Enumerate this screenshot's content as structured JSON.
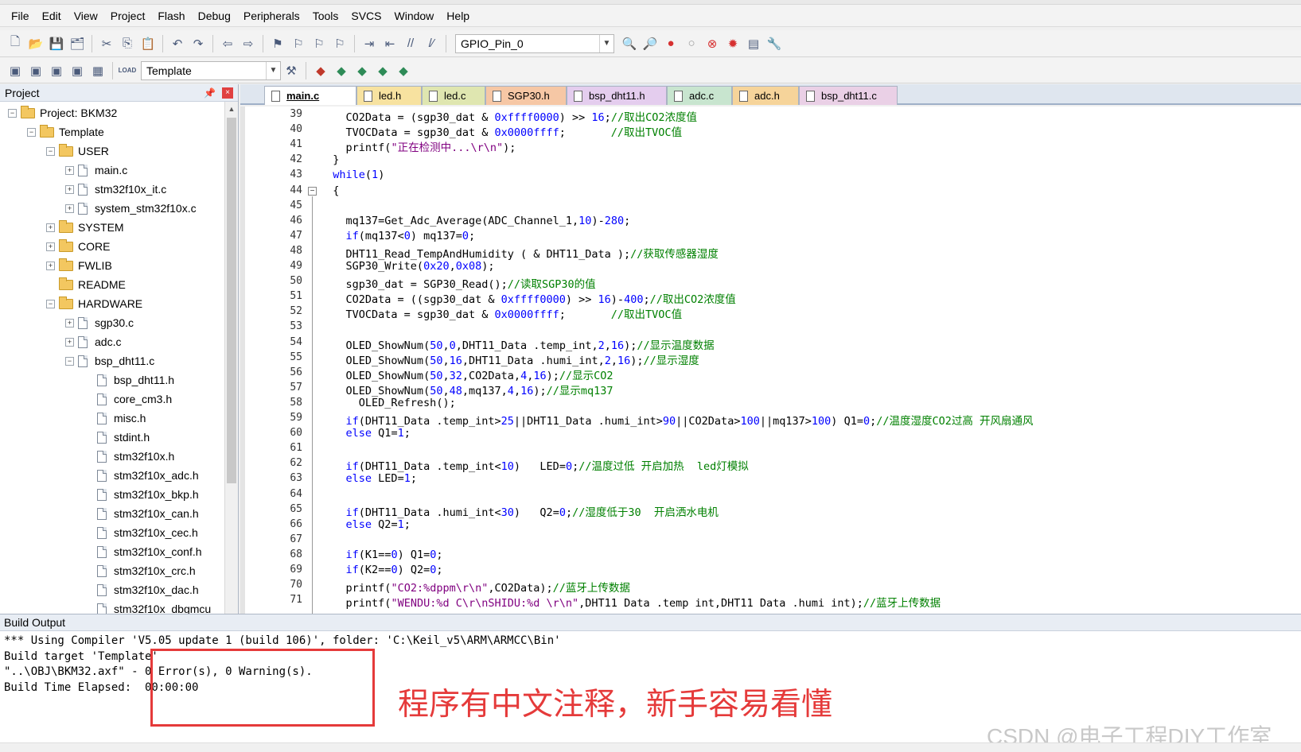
{
  "menu": [
    "File",
    "Edit",
    "View",
    "Project",
    "Flash",
    "Debug",
    "Peripherals",
    "Tools",
    "SVCS",
    "Window",
    "Help"
  ],
  "toolbar1": {
    "target_combo": "GPIO_Pin_0",
    "icons": [
      "new-file-icon",
      "open-folder-icon",
      "save-icon",
      "save-all-icon",
      "cut-icon",
      "copy-icon",
      "paste-icon",
      "undo-icon",
      "redo-icon",
      "nav-back-icon",
      "nav-forward-icon",
      "bookmark-icon",
      "bookmark-prev-icon",
      "bookmark-next-icon",
      "bookmark-clear-icon",
      "indent-icon",
      "unindent-icon",
      "comment-icon",
      "uncomment-icon",
      "find-in-files-icon",
      "find-icon",
      "breakpoint-icon",
      "breakpoint-disable-icon",
      "breakpoint-kill-icon",
      "breakpoint-all-icon",
      "window-layout-icon",
      "config-wrench-icon"
    ]
  },
  "toolbar2": {
    "target_combo": "Template",
    "load_label": "LOAD"
  },
  "project_panel": {
    "title": "Project",
    "tree": [
      {
        "level": 0,
        "toggle": "−",
        "type": "project",
        "label": "Project: BKM32"
      },
      {
        "level": 1,
        "toggle": "−",
        "type": "target",
        "label": "Template"
      },
      {
        "level": 2,
        "toggle": "−",
        "type": "folder",
        "label": "USER"
      },
      {
        "level": 3,
        "toggle": "+",
        "type": "file",
        "label": "main.c"
      },
      {
        "level": 3,
        "toggle": "+",
        "type": "file",
        "label": "stm32f10x_it.c"
      },
      {
        "level": 3,
        "toggle": "+",
        "type": "file",
        "label": "system_stm32f10x.c"
      },
      {
        "level": 2,
        "toggle": "+",
        "type": "folder",
        "label": "SYSTEM"
      },
      {
        "level": 2,
        "toggle": "+",
        "type": "folder",
        "label": "CORE"
      },
      {
        "level": 2,
        "toggle": "+",
        "type": "folder",
        "label": "FWLIB"
      },
      {
        "level": 2,
        "toggle": "",
        "type": "folder",
        "label": "README"
      },
      {
        "level": 2,
        "toggle": "−",
        "type": "folder",
        "label": "HARDWARE"
      },
      {
        "level": 3,
        "toggle": "+",
        "type": "file",
        "label": "sgp30.c"
      },
      {
        "level": 3,
        "toggle": "+",
        "type": "file",
        "label": "adc.c"
      },
      {
        "level": 3,
        "toggle": "−",
        "type": "file",
        "label": "bsp_dht11.c"
      },
      {
        "level": 4,
        "toggle": "",
        "type": "file",
        "label": "bsp_dht11.h"
      },
      {
        "level": 4,
        "toggle": "",
        "type": "file",
        "label": "core_cm3.h"
      },
      {
        "level": 4,
        "toggle": "",
        "type": "file",
        "label": "misc.h"
      },
      {
        "level": 4,
        "toggle": "",
        "type": "file",
        "label": "stdint.h"
      },
      {
        "level": 4,
        "toggle": "",
        "type": "file",
        "label": "stm32f10x.h"
      },
      {
        "level": 4,
        "toggle": "",
        "type": "file",
        "label": "stm32f10x_adc.h"
      },
      {
        "level": 4,
        "toggle": "",
        "type": "file",
        "label": "stm32f10x_bkp.h"
      },
      {
        "level": 4,
        "toggle": "",
        "type": "file",
        "label": "stm32f10x_can.h"
      },
      {
        "level": 4,
        "toggle": "",
        "type": "file",
        "label": "stm32f10x_cec.h"
      },
      {
        "level": 4,
        "toggle": "",
        "type": "file",
        "label": "stm32f10x_conf.h"
      },
      {
        "level": 4,
        "toggle": "",
        "type": "file",
        "label": "stm32f10x_crc.h"
      },
      {
        "level": 4,
        "toggle": "",
        "type": "file",
        "label": "stm32f10x_dac.h"
      },
      {
        "level": 4,
        "toggle": "",
        "type": "file",
        "label": "stm32f10x_dbgmcu"
      }
    ]
  },
  "tabs": [
    {
      "label": "main.c",
      "color": "#ffffff",
      "active": true
    },
    {
      "label": "led.h",
      "color": "#f7e2a0",
      "active": false
    },
    {
      "label": "led.c",
      "color": "#dfe6b0",
      "active": false
    },
    {
      "label": "SGP30.h",
      "color": "#f6c7a5",
      "active": false
    },
    {
      "label": "bsp_dht11.h",
      "color": "#e4cdee",
      "active": false
    },
    {
      "label": "adc.c",
      "color": "#c8e5cf",
      "active": false
    },
    {
      "label": "adc.h",
      "color": "#f6d49a",
      "active": false
    },
    {
      "label": "bsp_dht11.c",
      "color": "#ead0e6",
      "active": false
    }
  ],
  "editor": {
    "lines": [
      {
        "n": "39",
        "code": "    CO2Data = (sgp30_dat & 0xffff0000) >> 16;//取出CO2浓度值"
      },
      {
        "n": "40",
        "code": "    TVOCData = sgp30_dat & 0x0000ffff;       //取出TVOC值"
      },
      {
        "n": "41",
        "code": "    printf(\"正在检测中...\\r\\n\");"
      },
      {
        "n": "42",
        "code": "  }"
      },
      {
        "n": "43",
        "code": "  while(1)"
      },
      {
        "n": "44",
        "code": "  {"
      },
      {
        "n": "45",
        "code": ""
      },
      {
        "n": "46",
        "code": "    mq137=Get_Adc_Average(ADC_Channel_1,10)-280;"
      },
      {
        "n": "47",
        "code": "    if(mq137<0) mq137=0;"
      },
      {
        "n": "48",
        "code": "    DHT11_Read_TempAndHumidity ( & DHT11_Data );//获取传感器湿度"
      },
      {
        "n": "49",
        "code": "    SGP30_Write(0x20,0x08);"
      },
      {
        "n": "50",
        "code": "    sgp30_dat = SGP30_Read();//读取SGP30的值"
      },
      {
        "n": "51",
        "code": "    CO2Data = ((sgp30_dat & 0xffff0000) >> 16)-400;//取出CO2浓度值"
      },
      {
        "n": "52",
        "code": "    TVOCData = sgp30_dat & 0x0000ffff;       //取出TVOC值"
      },
      {
        "n": "53",
        "code": ""
      },
      {
        "n": "54",
        "code": "    OLED_ShowNum(50,0,DHT11_Data .temp_int,2,16);//显示温度数据"
      },
      {
        "n": "55",
        "code": "    OLED_ShowNum(50,16,DHT11_Data .humi_int,2,16);//显示湿度"
      },
      {
        "n": "56",
        "code": "    OLED_ShowNum(50,32,CO2Data,4,16);//显示CO2"
      },
      {
        "n": "57",
        "code": "    OLED_ShowNum(50,48,mq137,4,16);//显示mq137"
      },
      {
        "n": "58",
        "code": "      OLED_Refresh();"
      },
      {
        "n": "59",
        "code": "    if(DHT11_Data .temp_int>25||DHT11_Data .humi_int>90||CO2Data>100||mq137>100) Q1=0;//温度湿度CO2过高 开风扇通风"
      },
      {
        "n": "60",
        "code": "    else Q1=1;"
      },
      {
        "n": "61",
        "code": ""
      },
      {
        "n": "62",
        "code": "    if(DHT11_Data .temp_int<10)   LED=0;//温度过低 开启加热  led灯模拟"
      },
      {
        "n": "63",
        "code": "    else LED=1;"
      },
      {
        "n": "64",
        "code": ""
      },
      {
        "n": "65",
        "code": "    if(DHT11_Data .humi_int<30)   Q2=0;//湿度低于30  开启洒水电机"
      },
      {
        "n": "66",
        "code": "    else Q2=1;"
      },
      {
        "n": "67",
        "code": ""
      },
      {
        "n": "68",
        "code": "    if(K1==0) Q1=0;"
      },
      {
        "n": "69",
        "code": "    if(K2==0) Q2=0;"
      },
      {
        "n": "70",
        "code": "    printf(\"CO2:%dppm\\r\\n\",CO2Data);//蓝牙上传数据"
      },
      {
        "n": "71",
        "code": "    printf(\"WENDU:%d C\\r\\nSHIDU:%d \\r\\n\",DHT11 Data .temp int,DHT11 Data .humi int);//蓝牙上传数据"
      }
    ]
  },
  "build_output": {
    "title": "Build Output",
    "lines": [
      "*** Using Compiler 'V5.05 update 1 (build 106)', folder: 'C:\\Keil_v5\\ARM\\ARMCC\\Bin'",
      "Build target 'Template'",
      "\"..\\OBJ\\BKM32.axf\" - 0 Error(s), 0 Warning(s).",
      "Build Time Elapsed:  00:00:00"
    ]
  },
  "annotation": {
    "note": "程序有中文注释，新手容易看懂",
    "watermark": "CSDN @电子工程DIY工作室",
    "color": "#e53a3a"
  },
  "colors": {
    "keyword": "#0000ff",
    "comment": "#008000",
    "string": "#800080",
    "number": "#0000ff"
  }
}
